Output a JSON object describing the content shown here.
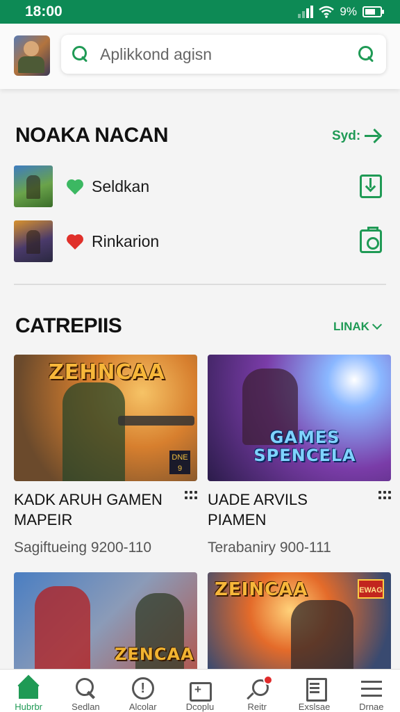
{
  "status": {
    "time": "18:00",
    "battery": "9%"
  },
  "search": {
    "placeholder": "Aplikkond agisn"
  },
  "recent": {
    "title": "NOAKA NACAN",
    "link": "Syd:",
    "items": [
      {
        "label": "Seldkan",
        "heart_color": "#3cb862",
        "action_icon": "download-icon"
      },
      {
        "label": "Rinkarion",
        "heart_color": "#e0302a",
        "action_icon": "camera-icon"
      }
    ]
  },
  "categories": {
    "title": "CATREPIIS",
    "link": "LINAK",
    "cards": [
      {
        "title": "KADK ARUH GAMEN MAPEIR",
        "subtitle": "Sagiftueing 9200-110",
        "logo": "ZEHNCAA",
        "badge": "DNE 9"
      },
      {
        "title": "UADE ARVILS PIAMEN",
        "subtitle": "Terabaniry 900-111",
        "logo": "GAMES SPENCELA"
      },
      {
        "logo": "ZENCAA"
      },
      {
        "logo": "ZEINCAA",
        "badge": "EWAG"
      }
    ]
  },
  "nav": {
    "items": [
      {
        "label": "Hubrbr"
      },
      {
        "label": "Sedlan"
      },
      {
        "label": "Alcolar"
      },
      {
        "label": "Dcoplu"
      },
      {
        "label": "Reitr"
      },
      {
        "label": "Exslsae"
      },
      {
        "label": "Drnae"
      }
    ]
  },
  "colors": {
    "brand": "#0d8a55",
    "accent": "#1f9a55"
  }
}
